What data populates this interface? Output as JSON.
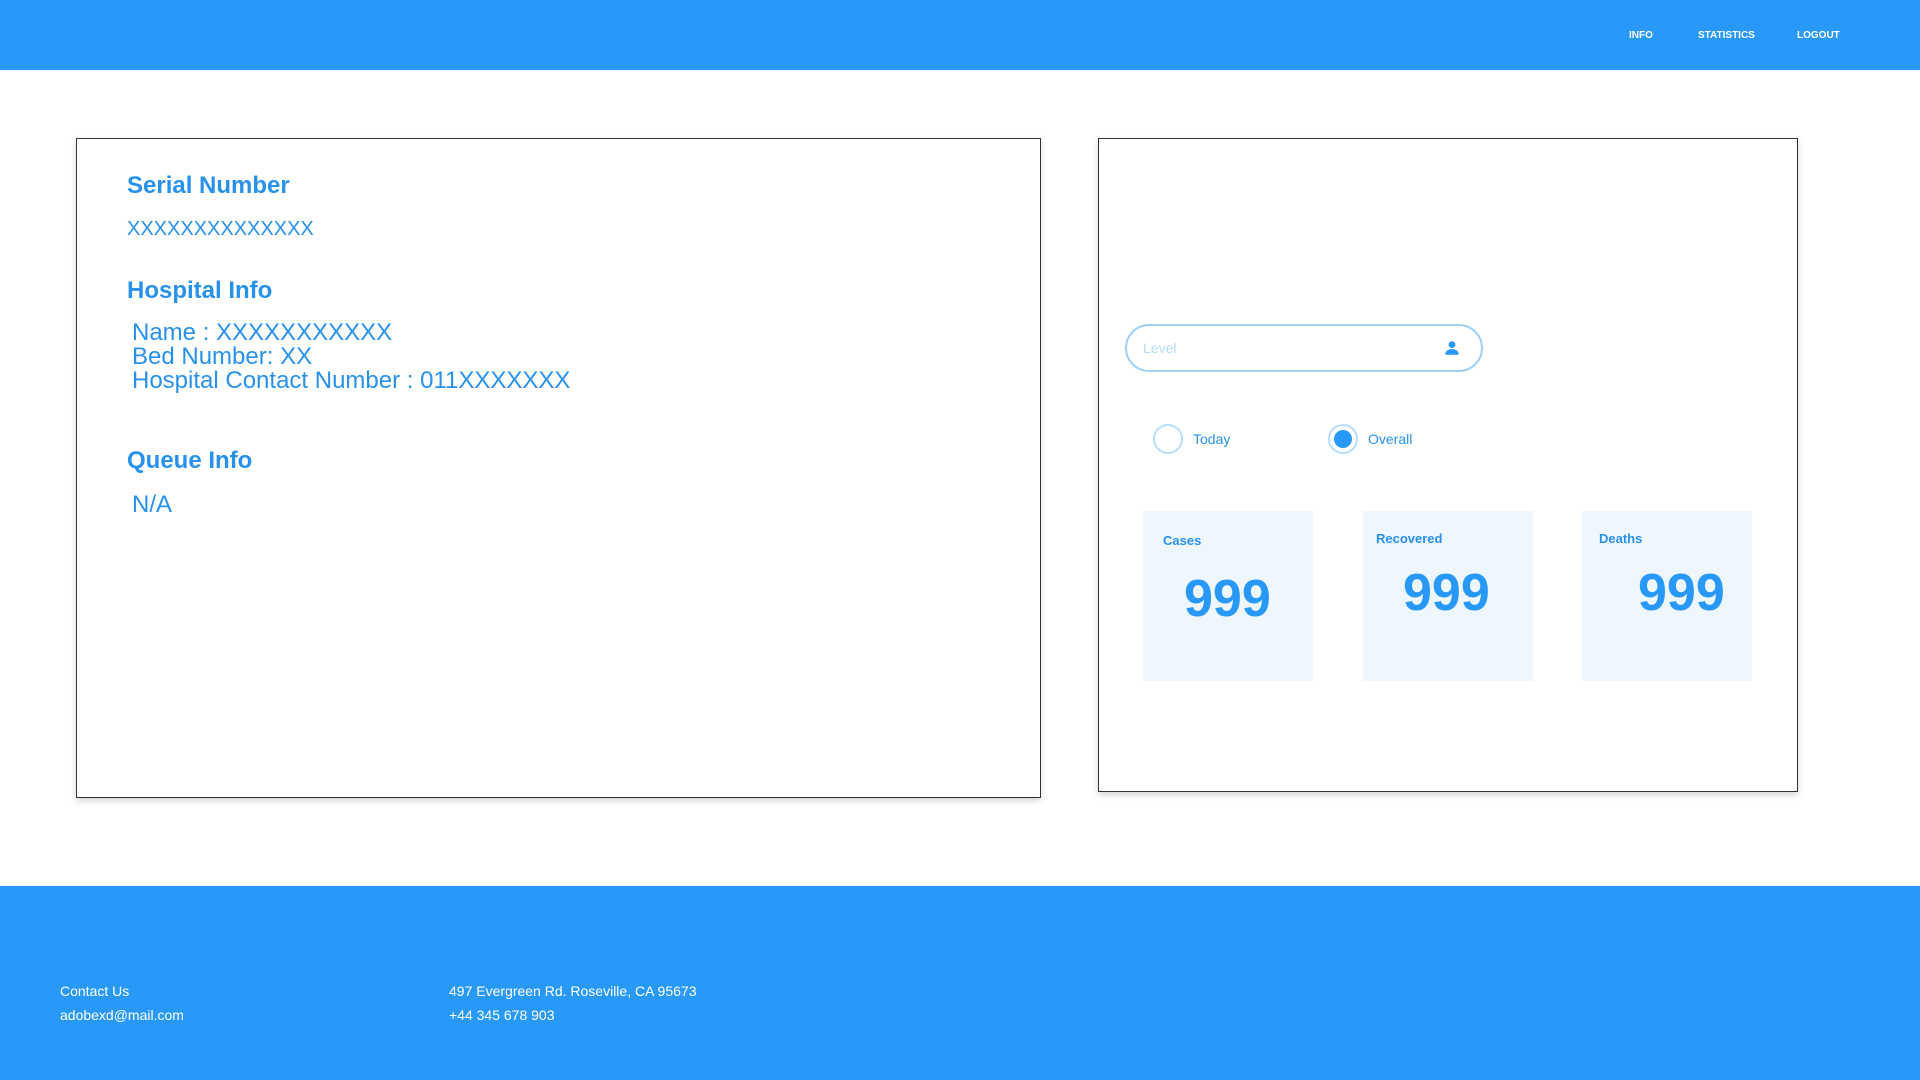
{
  "header": {
    "nav": [
      "INFO",
      "STATISTICS",
      "LOGOUT"
    ],
    "bg_color": "#2899f9"
  },
  "info_panel": {
    "serial_heading": "Serial Number",
    "serial_value": "XXXXXXXXXXXXXX",
    "hospital_heading": "Hospital Info",
    "hospital_lines": [
      "Name : XXXXXXXXXXX",
      "Bed Number: XX",
      "Hospital Contact Number : 011XXXXXXX"
    ],
    "queue_heading": "Queue Info",
    "queue_value": "N/A"
  },
  "stats_panel": {
    "level_placeholder": "Level",
    "level_icon": "user-icon",
    "radio_options": [
      {
        "label": "Today",
        "selected": false
      },
      {
        "label": "Overall",
        "selected": true
      }
    ],
    "cards": [
      {
        "label": "Cases",
        "value": "999"
      },
      {
        "label": "Recovered",
        "value": "999"
      },
      {
        "label": "Deaths",
        "value": "999"
      }
    ]
  },
  "footer": {
    "contact_label": "Contact Us",
    "email": "adobexd@mail.com",
    "address": "497 Evergreen Rd. Roseville, CA 95673",
    "phone": "+44 345 678 903"
  },
  "colors": {
    "accent": "#2899f9",
    "text_blue": "#2891ec",
    "card_bg": "#eef6fe"
  }
}
